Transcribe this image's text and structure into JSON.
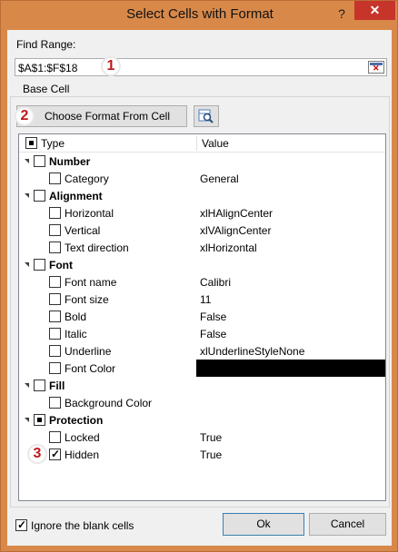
{
  "window": {
    "title": "Select Cells with Format",
    "help_glyph": "?",
    "close_glyph": "✕"
  },
  "find_range": {
    "label": "Find Range:",
    "value": "$A$1:$F$18"
  },
  "base_cell": {
    "group_label": "Base Cell",
    "choose_button": "Choose Format From Cell"
  },
  "tree": {
    "header": {
      "type": "Type",
      "value": "Value"
    },
    "rows": [
      {
        "kind": "category",
        "name": "Number",
        "checked": false
      },
      {
        "kind": "item",
        "name": "Category",
        "value": "General",
        "checked": false
      },
      {
        "kind": "category",
        "name": "Alignment",
        "checked": false
      },
      {
        "kind": "item",
        "name": "Horizontal",
        "value": "xlHAlignCenter",
        "checked": false
      },
      {
        "kind": "item",
        "name": "Vertical",
        "value": "xlVAlignCenter",
        "checked": false
      },
      {
        "kind": "item",
        "name": "Text direction",
        "value": "xlHorizontal",
        "checked": false
      },
      {
        "kind": "category",
        "name": "Font",
        "checked": false
      },
      {
        "kind": "item",
        "name": "Font name",
        "value": "Calibri",
        "checked": false
      },
      {
        "kind": "item",
        "name": "Font size",
        "value": "11",
        "checked": false
      },
      {
        "kind": "item",
        "name": "Bold",
        "value": "False",
        "checked": false
      },
      {
        "kind": "item",
        "name": "Italic",
        "value": "False",
        "checked": false
      },
      {
        "kind": "item",
        "name": "Underline",
        "value": "xlUnderlineStyleNone",
        "checked": false
      },
      {
        "kind": "item",
        "name": "Font Color",
        "value": "",
        "swatch": "#000000",
        "checked": false
      },
      {
        "kind": "category",
        "name": "Fill",
        "checked": false
      },
      {
        "kind": "item",
        "name": "Background Color",
        "value": "",
        "checked": false
      },
      {
        "kind": "category",
        "name": "Protection",
        "checked": "partial"
      },
      {
        "kind": "item",
        "name": "Locked",
        "value": "True",
        "checked": false
      },
      {
        "kind": "item",
        "name": "Hidden",
        "value": "True",
        "checked": true
      }
    ]
  },
  "footer": {
    "ignore_blank_label": "Ignore the blank cells",
    "ignore_blank_checked": true,
    "ok_label": "Ok",
    "cancel_label": "Cancel"
  },
  "annotations": {
    "step1": "1",
    "step2": "2",
    "step3": "3"
  },
  "colors": {
    "window_frame": "#d8894a",
    "close_button": "#c7342a",
    "annotation_number": "#c0171b",
    "dialog_bg": "#f0f0f0"
  }
}
